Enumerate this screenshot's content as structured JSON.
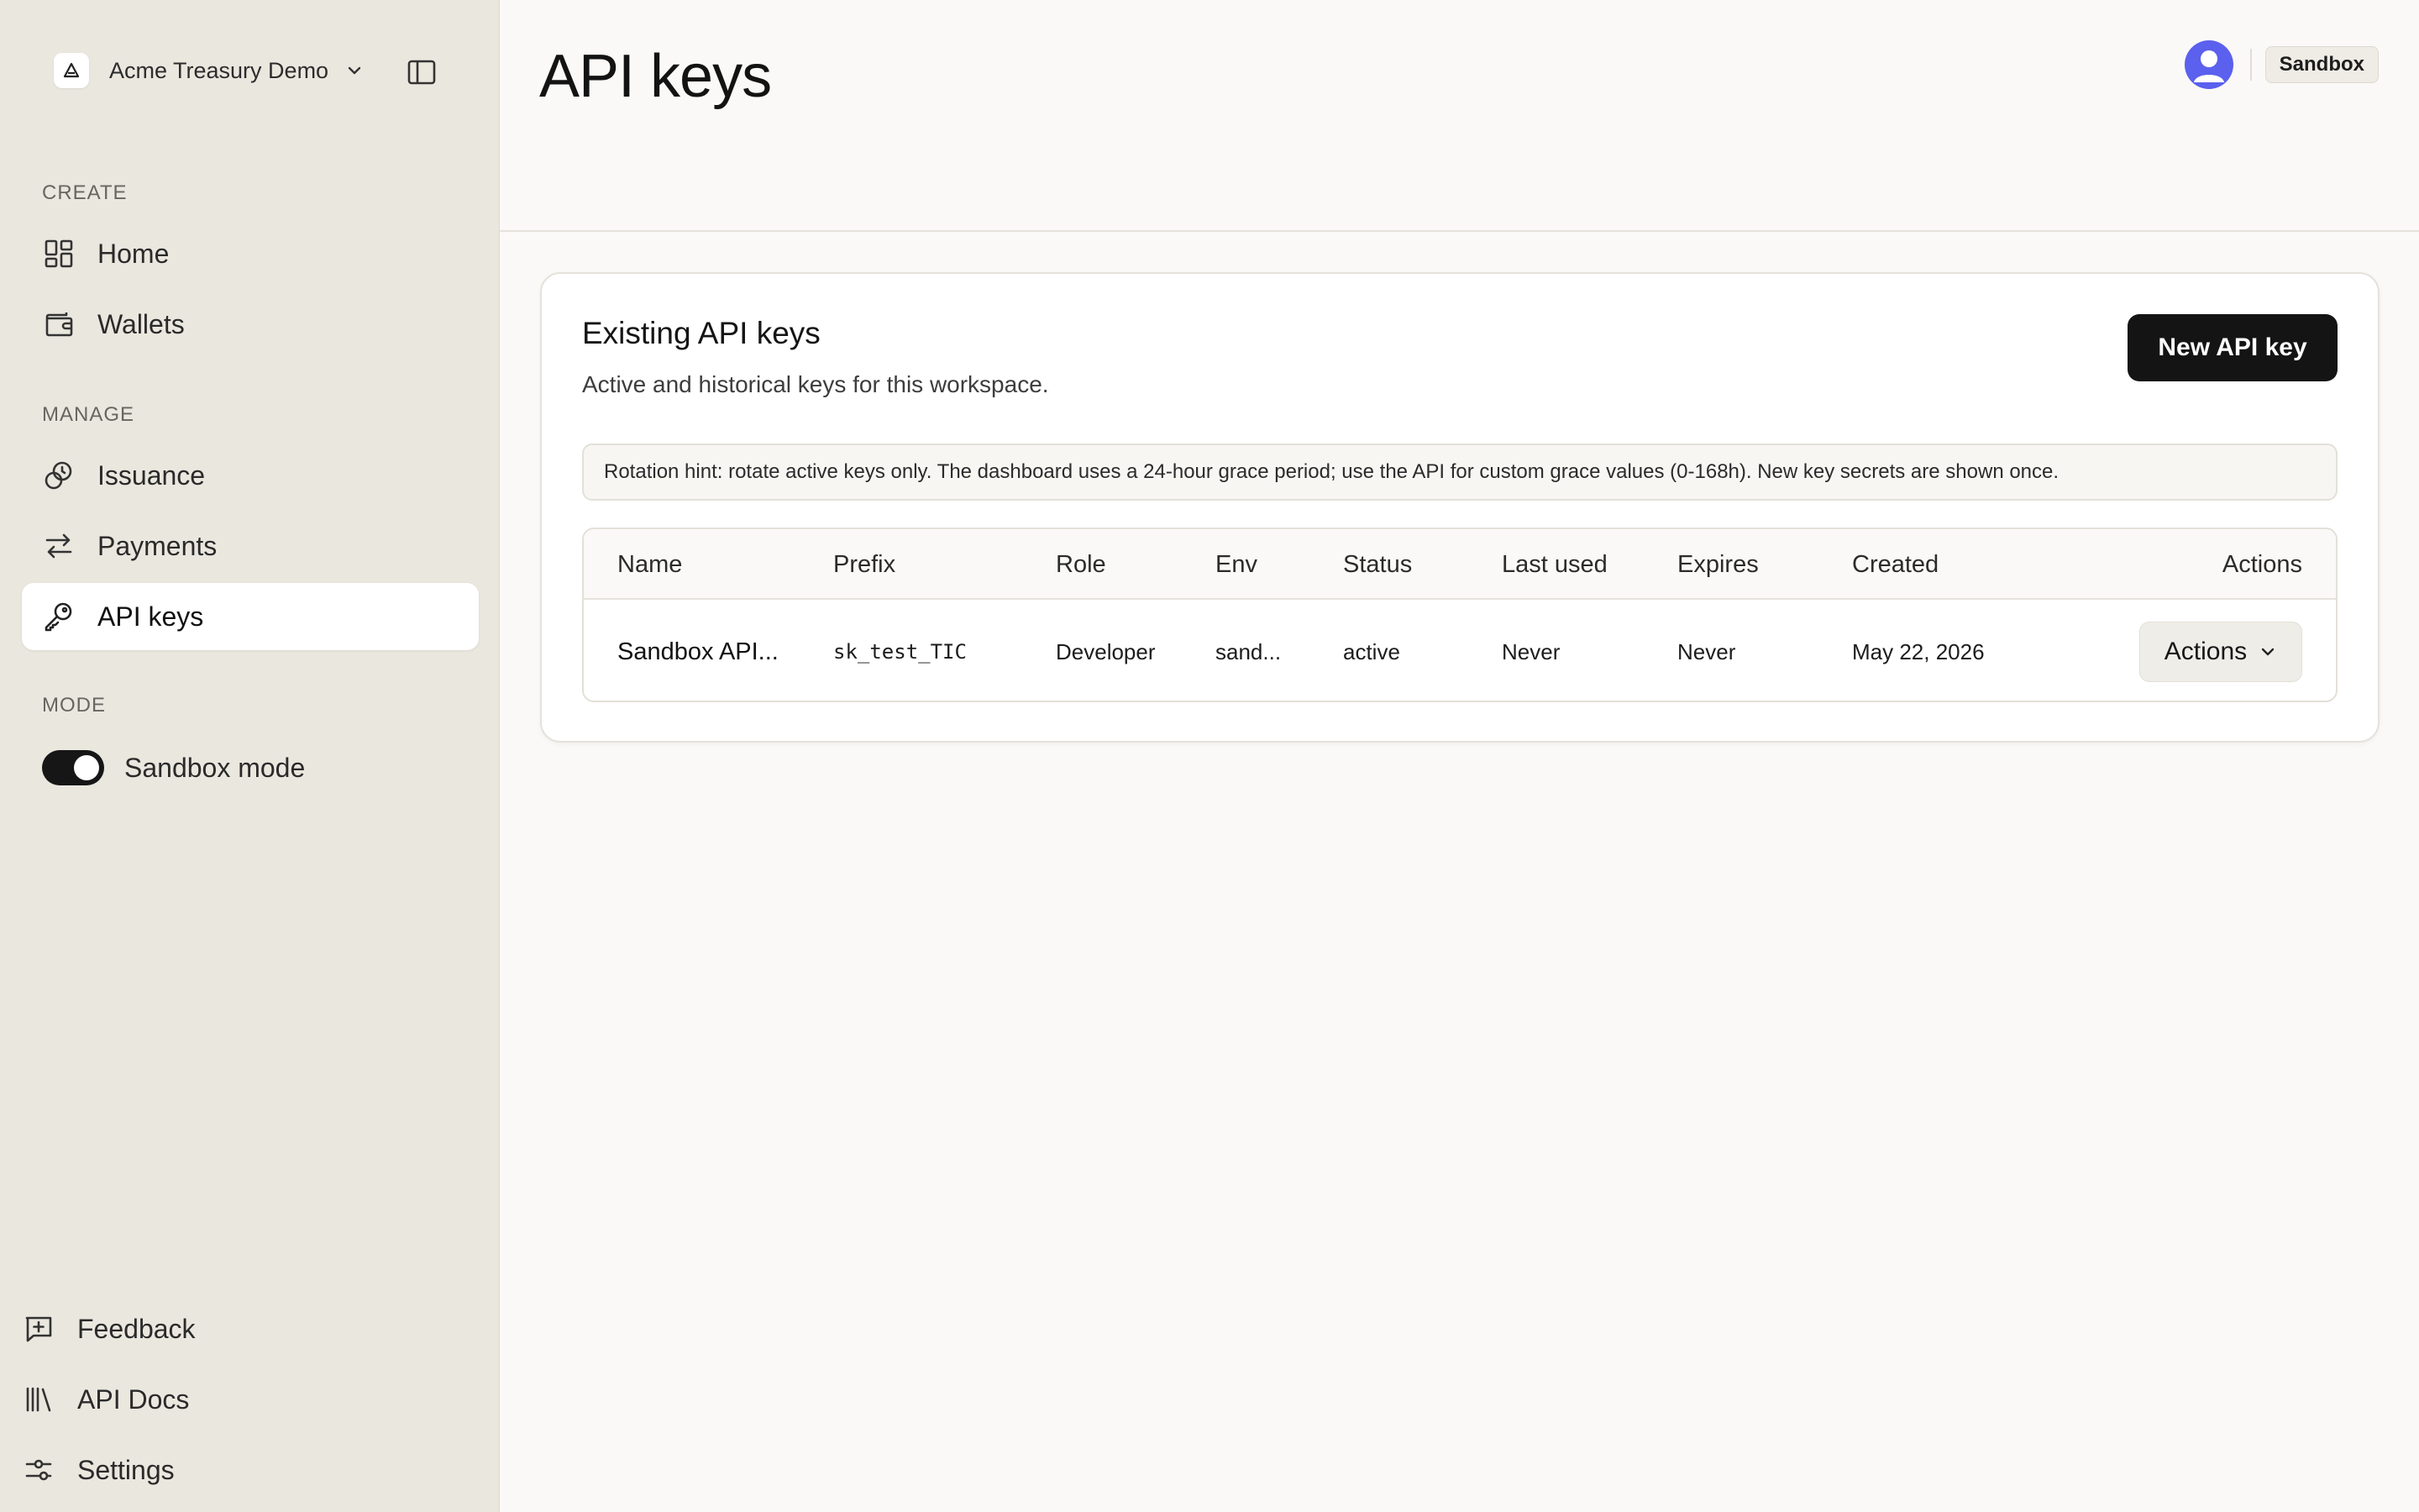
{
  "sidebar": {
    "workspace_name": "Acme Treasury Demo",
    "sections": {
      "create": "CREATE",
      "manage": "MANAGE",
      "mode": "MODE"
    },
    "items": {
      "home": "Home",
      "wallets": "Wallets",
      "issuance": "Issuance",
      "payments": "Payments",
      "api_keys": "API keys"
    },
    "active_item": "api_keys",
    "mode_toggle": {
      "label": "Sandbox mode",
      "enabled": true
    },
    "bottom": {
      "feedback": "Feedback",
      "api_docs": "API Docs",
      "settings": "Settings"
    }
  },
  "header": {
    "title": "API keys",
    "environment_badge": "Sandbox"
  },
  "card": {
    "title": "Existing API keys",
    "subtitle": "Active and historical keys for this workspace.",
    "new_button": "New API key",
    "hint": "Rotation hint: rotate active keys only. The dashboard uses a 24-hour grace period; use the API for custom grace values (0-168h). New key secrets are shown once."
  },
  "table": {
    "columns": {
      "name": "Name",
      "prefix": "Prefix",
      "role": "Role",
      "env": "Env",
      "status": "Status",
      "last_used": "Last used",
      "expires": "Expires",
      "created": "Created",
      "actions": "Actions"
    },
    "rows": [
      {
        "name": "Sandbox API...",
        "prefix": "sk_test_TIC",
        "role": "Developer",
        "env": "sand...",
        "status": "active",
        "last_used": "Never",
        "expires": "Never",
        "created": "May 22, 2026",
        "actions": "Actions"
      }
    ]
  },
  "colors": {
    "sidebar_bg": "#eae7df",
    "main_bg": "#faf9f7",
    "primary_button": "#141414",
    "avatar": "#5b60ee"
  }
}
